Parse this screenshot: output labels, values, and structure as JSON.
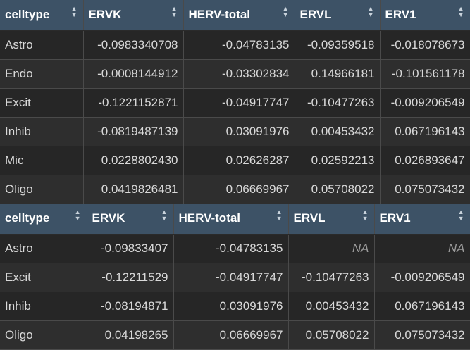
{
  "table1": {
    "columns": [
      "celltype",
      "ERVK",
      "HERV-total",
      "ERVL",
      "ERV1"
    ],
    "rows": [
      [
        "Astro",
        "-0.0983340708",
        "-0.04783135",
        "-0.09359518",
        "-0.018078673"
      ],
      [
        "Endo",
        "-0.0008144912",
        "-0.03302834",
        "0.14966181",
        "-0.101561178"
      ],
      [
        "Excit",
        "-0.1221152871",
        "-0.04917747",
        "-0.10477263",
        "-0.009206549"
      ],
      [
        "Inhib",
        "-0.0819487139",
        "0.03091976",
        "0.00453432",
        "0.067196143"
      ],
      [
        "Mic",
        "0.0228802430",
        "0.02626287",
        "0.02592213",
        "0.026893647"
      ],
      [
        "Oligo",
        "0.0419826481",
        "0.06669967",
        "0.05708022",
        "0.075073432"
      ]
    ]
  },
  "table2": {
    "columns": [
      "celltype",
      "ERVK",
      "HERV-total",
      "ERVL",
      "ERV1"
    ],
    "rows": [
      [
        "Astro",
        "-0.09833407",
        "-0.04783135",
        "NA",
        "NA"
      ],
      [
        "Excit",
        "-0.12211529",
        "-0.04917747",
        "-0.10477263",
        "-0.009206549"
      ],
      [
        "Inhib",
        "-0.08194871",
        "0.03091976",
        "0.00453432",
        "0.067196143"
      ],
      [
        "Oligo",
        "0.04198265",
        "0.06669967",
        "0.05708022",
        "0.075073432"
      ]
    ]
  },
  "icons": {
    "sort": "sort-arrows-icon"
  }
}
